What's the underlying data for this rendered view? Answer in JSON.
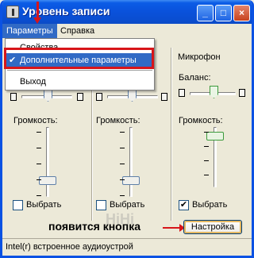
{
  "window": {
    "title": "Уровень записи",
    "buttons": {
      "minimize": "_",
      "maximize": "□",
      "close": "×"
    }
  },
  "menu": {
    "items": [
      "Параметры",
      "Справка"
    ],
    "dropdown": {
      "items": [
        {
          "label": "Свойства",
          "checked": false
        },
        {
          "label": "Дополнительные параметры",
          "checked": true
        },
        {
          "label": "Выход",
          "checked": false
        }
      ],
      "check_glyph": "✔"
    }
  },
  "columns": [
    {
      "title": "",
      "volume_label": "Громкость:",
      "select_label": "Выбрать",
      "selected": false
    },
    {
      "title": "",
      "volume_label": "Громкость:",
      "select_label": "Выбрать",
      "selected": false
    },
    {
      "title": "Микрофон",
      "balance_label": "Баланс:",
      "volume_label": "Громкость:",
      "select_label": "Выбрать",
      "selected": true,
      "settings_button": "Настройка"
    }
  ],
  "annotation": "появится кнопка",
  "watermark": "HiHi",
  "statusbar": "Intel(r) встроенное аудиоустрой",
  "colors": {
    "accent": "#0a52e3",
    "highlight": "#316ac5",
    "annotation_red": "#d7151a"
  }
}
